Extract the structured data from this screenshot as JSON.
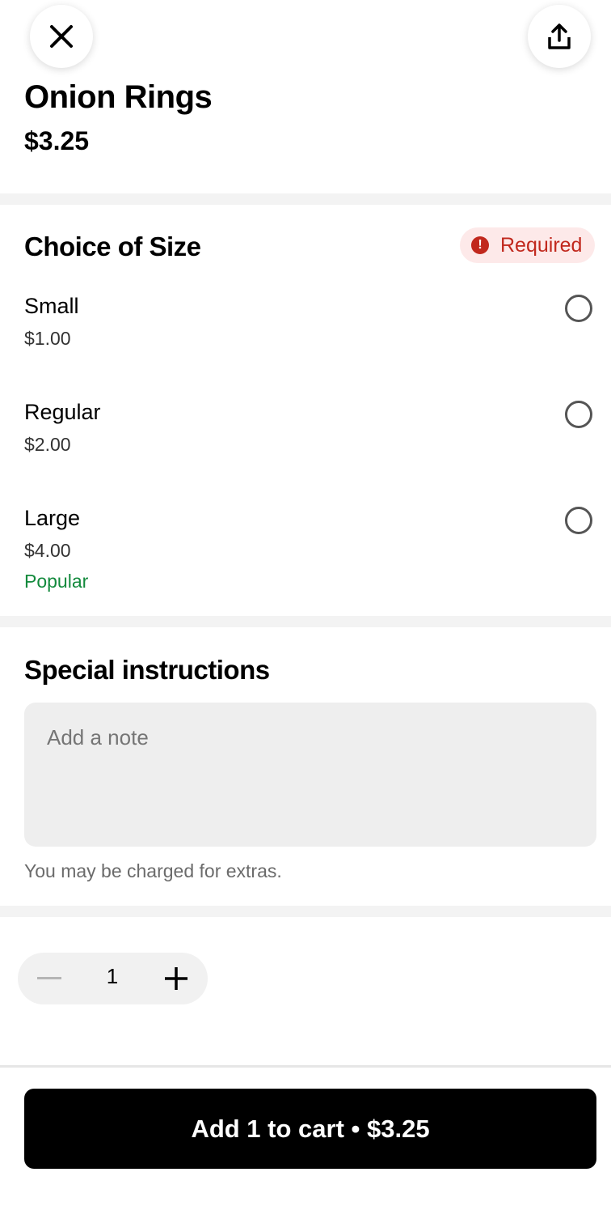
{
  "header": {
    "close_icon": "close-icon",
    "share_icon": "share-icon"
  },
  "item": {
    "title": "Onion Rings",
    "price": "$3.25"
  },
  "size_section": {
    "title": "Choice of Size",
    "required_label": "Required",
    "required_icon": "alert-icon",
    "options": [
      {
        "name": "Small",
        "price": "$1.00",
        "tag": ""
      },
      {
        "name": "Regular",
        "price": "$2.00",
        "tag": ""
      },
      {
        "name": "Large",
        "price": "$4.00",
        "tag": "Popular"
      }
    ]
  },
  "instructions": {
    "title": "Special instructions",
    "placeholder": "Add a note",
    "value": "",
    "hint": "You may be charged for extras."
  },
  "quantity": {
    "value": "1",
    "minus_icon": "minus-icon",
    "plus_icon": "plus-icon"
  },
  "cart_button": {
    "label": "Add 1 to cart • $3.25"
  },
  "colors": {
    "accent": "#000000",
    "required_text": "#c1281d",
    "required_bg": "#fde9e9",
    "popular": "#138a3d"
  }
}
